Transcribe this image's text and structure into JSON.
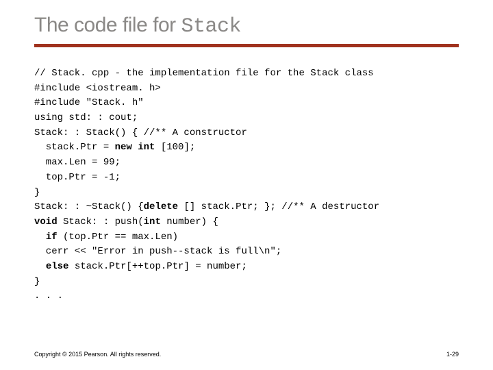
{
  "title_prefix": "The code file for ",
  "title_code": "Stack",
  "code_lines": [
    {
      "pre": "// Stack. cpp - the implementation file for the Stack class",
      "bold": "",
      "post": ""
    },
    {
      "pre": "#include <iostream. h>",
      "bold": "",
      "post": ""
    },
    {
      "pre": "#include \"Stack. h\"",
      "bold": "",
      "post": ""
    },
    {
      "pre": "using std: : cout;",
      "bold": "",
      "post": ""
    },
    {
      "pre": "Stack: : Stack() { //** A constructor",
      "bold": "",
      "post": ""
    },
    {
      "pre": "  stack.Ptr = ",
      "bold": "new int",
      "post": " [100];"
    },
    {
      "pre": "  max.Len = 99;",
      "bold": "",
      "post": ""
    },
    {
      "pre": "  top.Ptr = -1;",
      "bold": "",
      "post": ""
    },
    {
      "pre": "}",
      "bold": "",
      "post": ""
    },
    {
      "pre": "Stack: : ~Stack() {",
      "bold": "delete",
      "post": " [] stack.Ptr; }; //** A destructor"
    },
    {
      "pre": "",
      "bold": "void",
      "post": " Stack: : push(",
      "bold2": "int",
      "post2": " number) {"
    },
    {
      "pre": "  ",
      "bold": "if",
      "post": " (top.Ptr == max.Len)"
    },
    {
      "pre": "  cerr << \"Error in push--stack is full\\n\";",
      "bold": "",
      "post": ""
    },
    {
      "pre": "  ",
      "bold": "else",
      "post": " stack.Ptr[++top.Ptr] = number;"
    },
    {
      "pre": "}",
      "bold": "",
      "post": ""
    },
    {
      "pre": ". . .",
      "bold": "",
      "post": ""
    }
  ],
  "footer_left": "Copyright © 2015 Pearson. All rights reserved.",
  "footer_right": "1-29"
}
